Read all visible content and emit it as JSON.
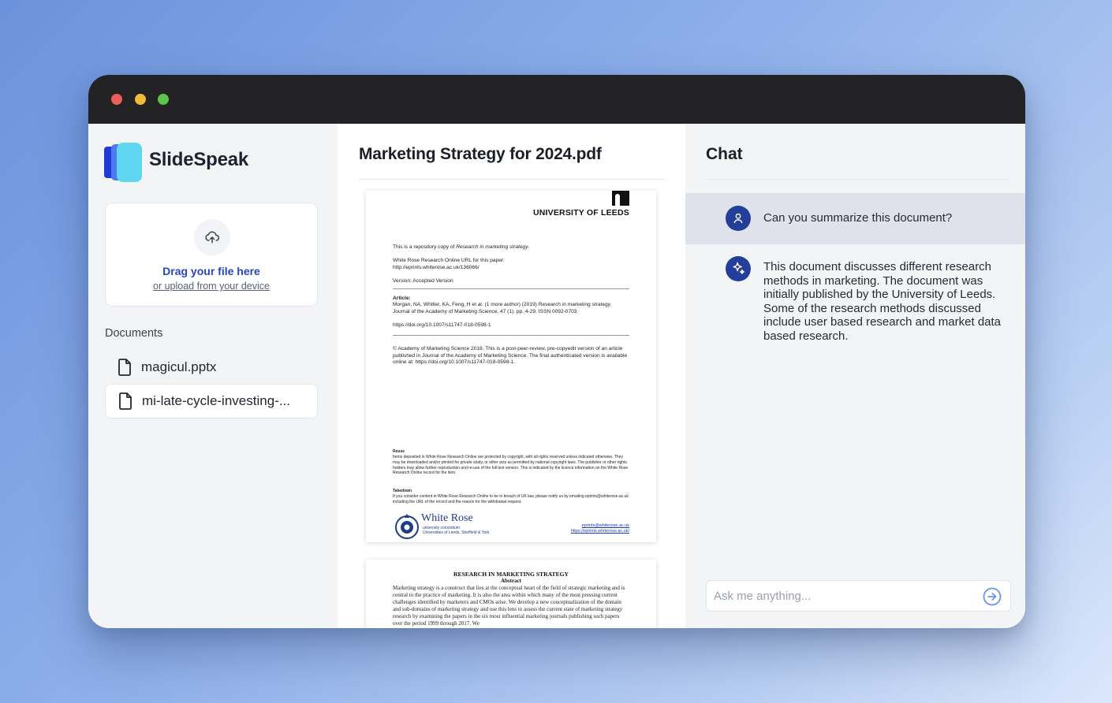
{
  "window": {
    "controls": [
      "close",
      "minimize",
      "maximize"
    ]
  },
  "sidebar": {
    "brand": "SlideSpeak",
    "upload": {
      "title": "Drag your file here",
      "link": "or upload from your device"
    },
    "documents_heading": "Documents",
    "documents": [
      {
        "label": "magicul.pptx",
        "icon": "file-icon",
        "active": false
      },
      {
        "label": "mi-late-cycle-investing-...",
        "icon": "file-icon",
        "active": true
      }
    ]
  },
  "viewer": {
    "title": "Marketing Strategy for 2024.pdf",
    "page1": {
      "institution": "UNIVERSITY OF LEEDS",
      "intro_prefix": "This is a repository copy of ",
      "intro_title": "Research in marketing strategy",
      "intro_suffix": ".",
      "url_label": "White Rose Research Online URL for this paper:",
      "url": "http://eprints.whiterose.ac.uk/136066/",
      "version": "Version: Accepted Version",
      "article_label": "Article:",
      "article_citation": "Morgan, NA, Whitler, KA, Feng, H et al. (1 more author) (2019) Research in marketing strategy. Journal of the Academy of Marketing Science, 47 (1). pp. 4-29. ISSN 0092-0703",
      "doi": "https://doi.org/10.1007/s11747-018-0598-1",
      "copyright": "© Academy of Marketing Science 2018. This is a post-peer-review, pre-copyedit version of an article published in Journal of the Academy of Marketing Science. The final authenticated version is available online at: https://doi.org/10.1007/s11747-018-0598-1.",
      "reuse_heading": "Reuse",
      "reuse_text": "Items deposited in White Rose Research Online are protected by copyright, with all rights reserved unless indicated otherwise. They may be downloaded and/or printed for private study, or other acts as permitted by national copyright laws. The publisher or other rights holders may allow further reproduction and re-use of the full text version. This is indicated by the licence information on the White Rose Research Online record for the item.",
      "takedown_heading": "Takedown",
      "takedown_text": "If you consider content in White Rose Research Online to be in breach of UK law, please notify us by emailing eprints@whiterose.ac.uk including the URL of the record and the reason for the withdrawal request.",
      "footer_logo": "White Rose",
      "footer_logo_sub1": "university consortium",
      "footer_logo_sub2": "Universities of Leeds, Sheffield & York",
      "footer_email": "eprints@whiterose.ac.uk",
      "footer_url": "https://eprints.whiterose.ac.uk/"
    },
    "page2": {
      "title": "RESEARCH IN MARKETING STRATEGY",
      "subtitle": "Abstract",
      "body": "Marketing strategy is a construct that lies at the conceptual heart of the field of strategic marketing and is central to the practice of marketing. It is also the area within which many of the most pressing current challenges identified by marketers and CMOs arise. We develop a new conceptualization of the domain and sub-domains of marketing strategy and use this lens to assess the current state of marketing strategy research by examining the papers in the six most influential marketing journals publishing such papers over the period 1999 through 2017. We"
    }
  },
  "chat": {
    "title": "Chat",
    "messages": [
      {
        "role": "user",
        "icon": "user-icon",
        "text": "Can you summarize this document?"
      },
      {
        "role": "assistant",
        "icon": "sparkle-icon",
        "text": "This document discusses different research methods in marketing. The document was initially published by the University of Leeds. Some of the research methods discussed include user based research and market data based research."
      }
    ],
    "input": {
      "placeholder": "Ask me anything...",
      "value": ""
    },
    "send_icon": "send-arrow-icon"
  },
  "colors": {
    "accent": "#2746b9",
    "avatar": "#233f9a",
    "titlebar": "#232325",
    "close": "#ec5f56",
    "minimize": "#f2bc3a",
    "maximize": "#5bc44a"
  }
}
